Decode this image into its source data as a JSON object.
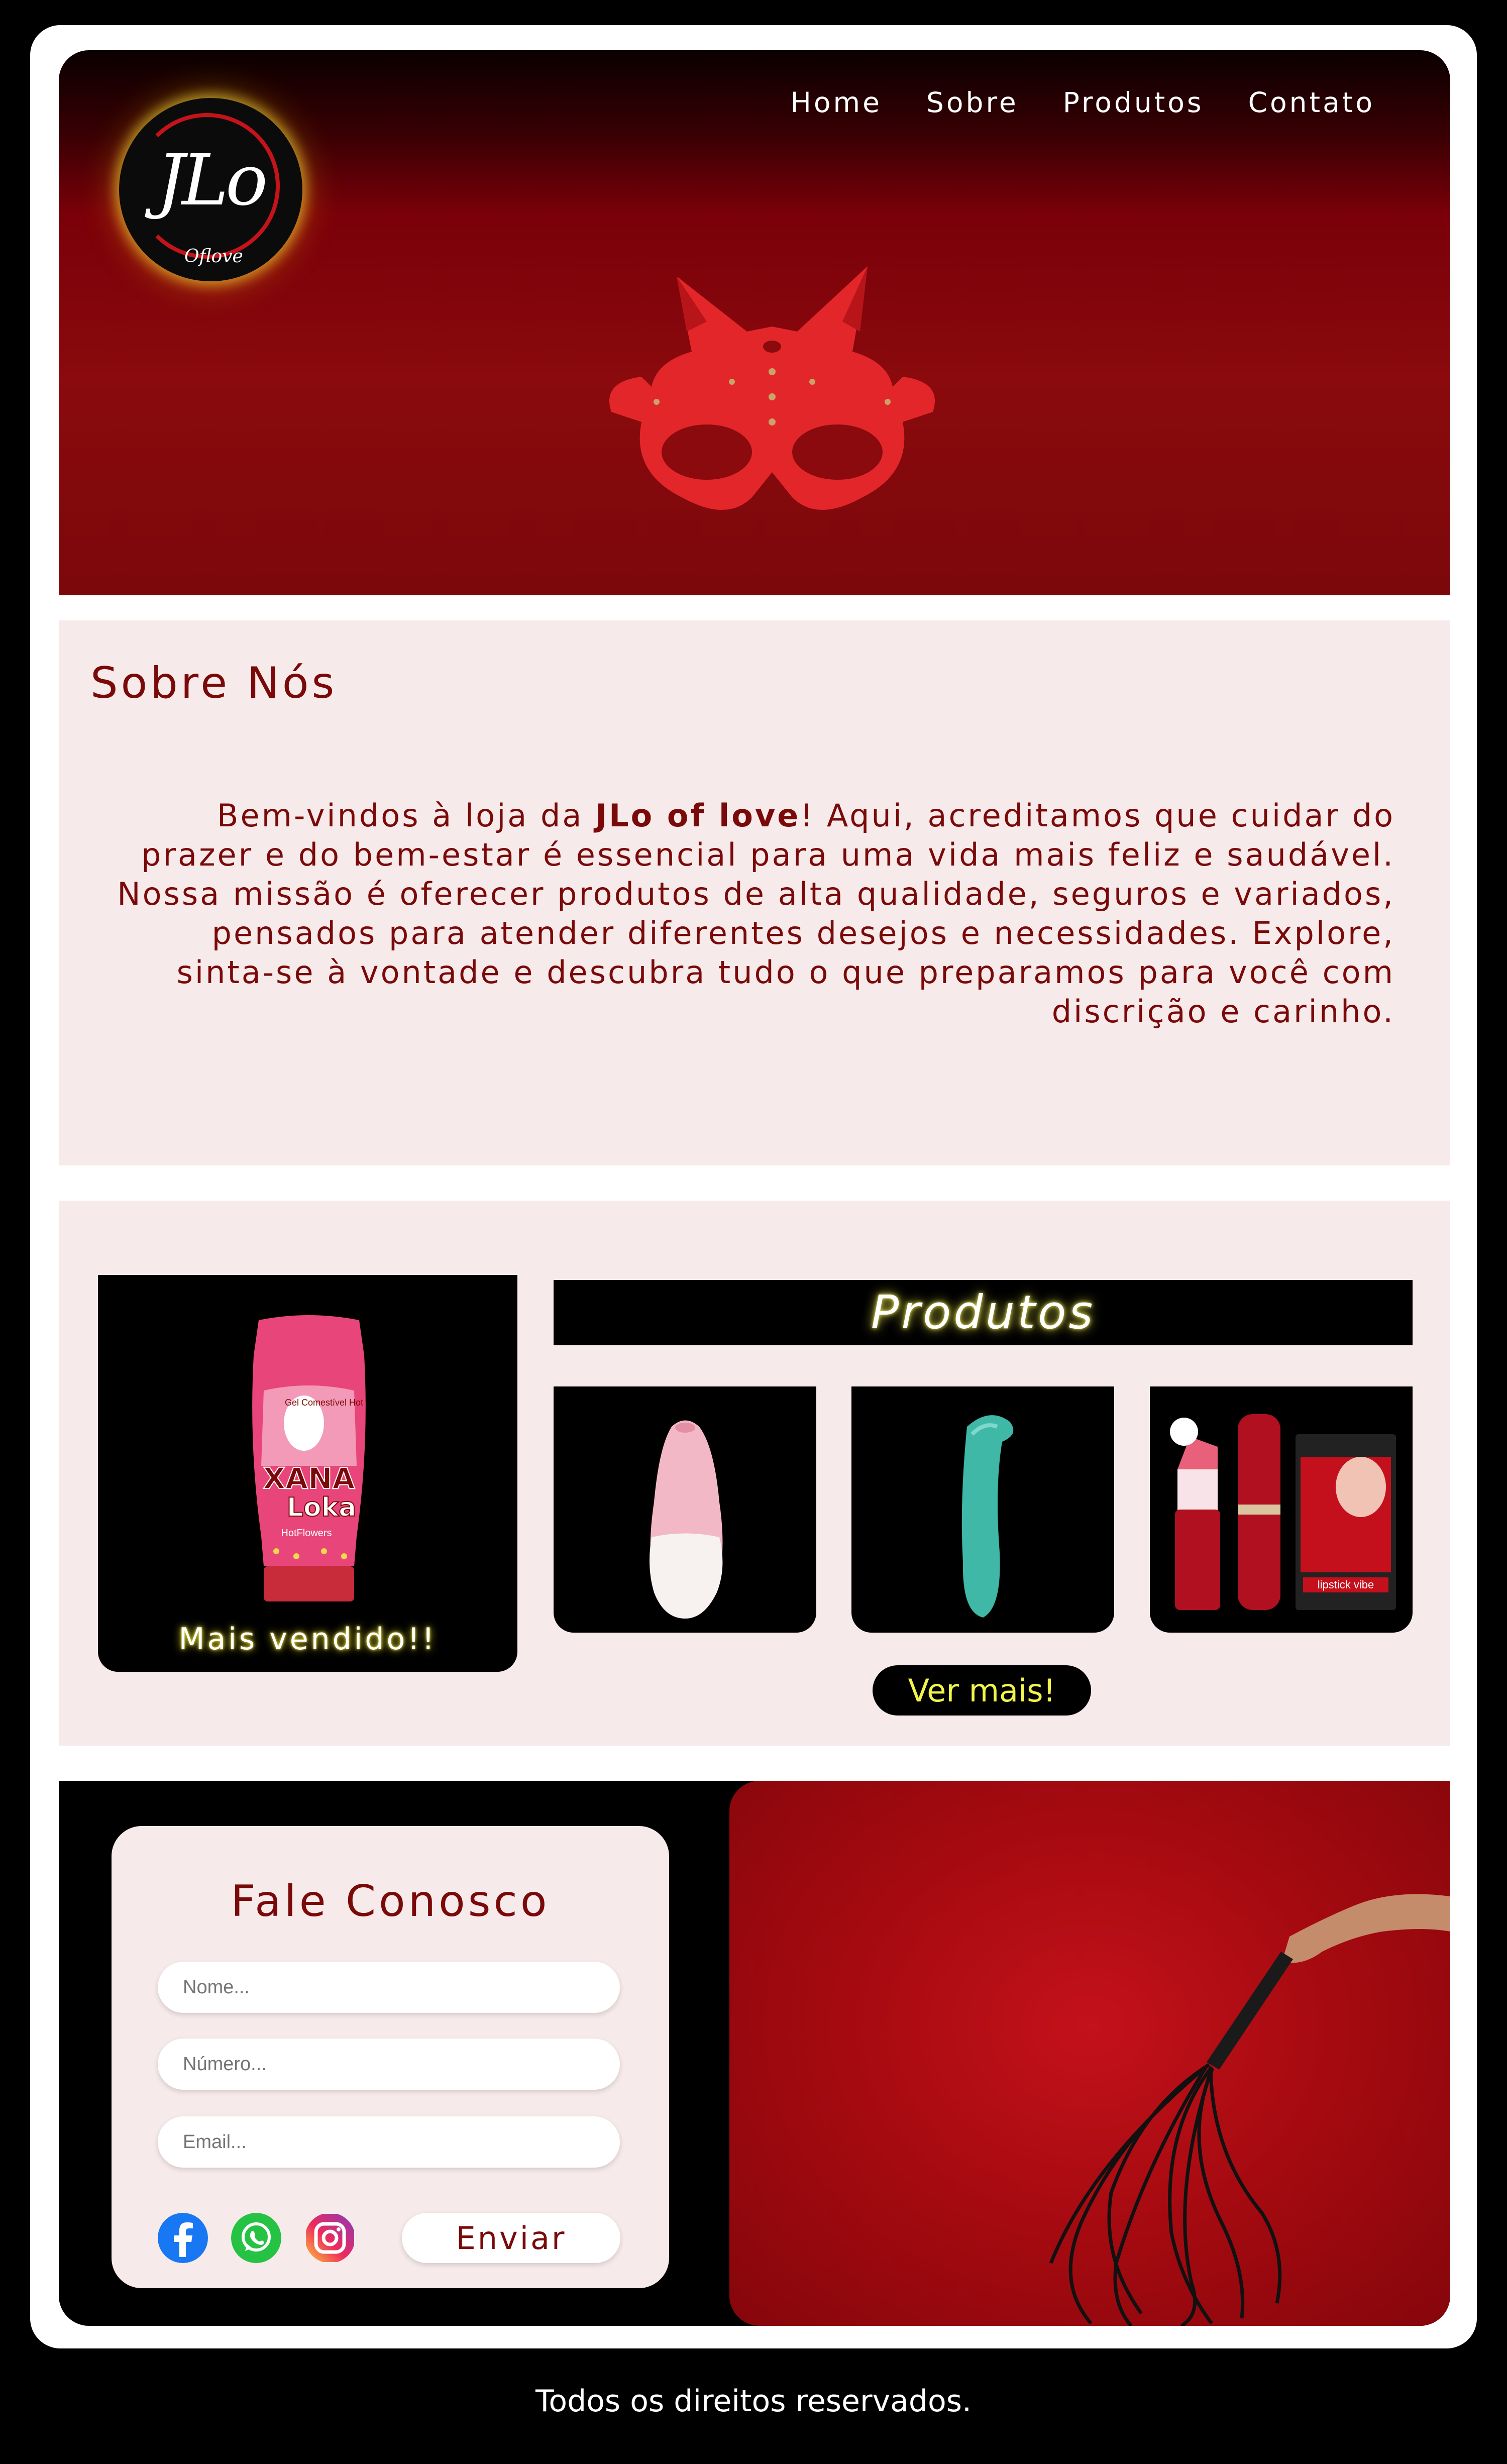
{
  "logo": {
    "main": "JLo",
    "sub": "Oflove"
  },
  "nav": {
    "home": "Home",
    "sobre": "Sobre",
    "produtos": "Produtos",
    "contato": "Contato"
  },
  "about": {
    "title": "Sobre Nós",
    "text_before": "Bem-vindos à loja da ",
    "brand": "JLo of love",
    "text_after": "! Aqui, acreditamos que cuidar do prazer e do bem-estar é essencial para uma vida mais feliz e saudável. Nossa missão é oferecer produtos de alta qualidade, seguros e variados, pensados para atender diferentes desejos e necessidades. Explore, sinta-se à vontade e descubra tudo o que preparamos para você com discrição e carinho."
  },
  "products": {
    "title": "Produtos",
    "best_seller_label": "Mais vendido!!",
    "best_seller_package_text": [
      "Gel Comestível Hot",
      "XANA",
      "Loka",
      "HotFlowers"
    ],
    "see_more": "Ver mais!",
    "lipstick_box_text": "lipstick vibe"
  },
  "contact": {
    "title": "Fale Conosco",
    "name_placeholder": "Nome...",
    "number_placeholder": "Número...",
    "email_placeholder": "Email...",
    "submit": "Enviar"
  },
  "footer": {
    "text": "Todos os direitos reservados."
  },
  "colors": {
    "brand_dark_red": "#7a0a0a",
    "hero_red": "#8a0a0d",
    "panel_pink": "#f7eaea",
    "glow_yellow": "#f2e633"
  }
}
